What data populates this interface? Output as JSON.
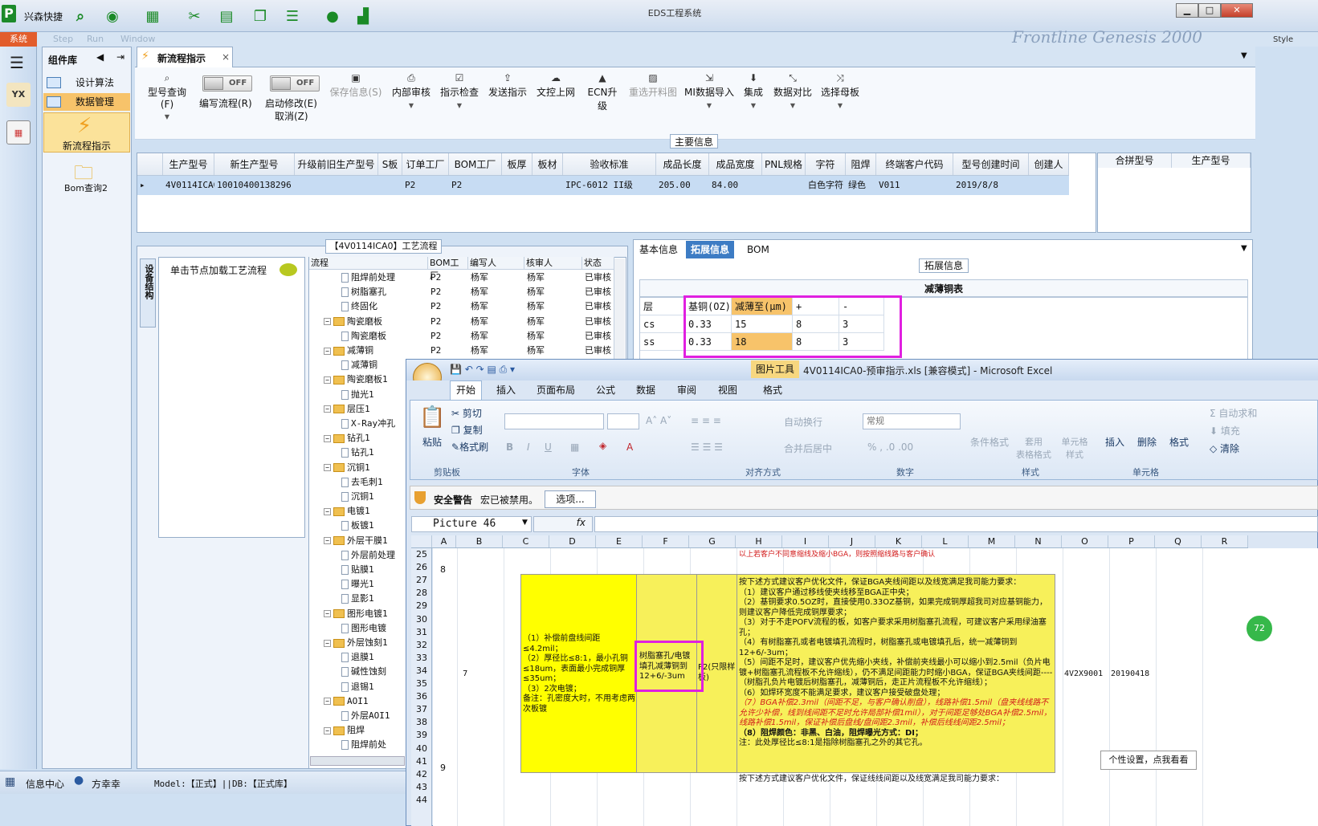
{
  "titlebar": {
    "app_logo": "P",
    "app_name": "兴森快捷",
    "window_title": "EDS工程系统",
    "win_min": "▁",
    "win_max": "□",
    "win_close": "✕",
    "icons": [
      "search-icon",
      "globe-icon",
      "grid-icon",
      "scissors-icon",
      "film-icon",
      "copy-icon",
      "list-icon",
      "user-icon",
      "chart-icon"
    ]
  },
  "menu": {
    "sys_tab": "系统",
    "ghost_items": [
      "Step",
      "Run",
      "Window"
    ],
    "brand": "Frontline Genesis 2000",
    "style_label": "Style"
  },
  "leftnav": {
    "yx": "YX",
    "calc": "▦"
  },
  "component_panel": {
    "title": "组件库",
    "items": [
      "设计算法",
      "数据管理"
    ],
    "new_flow": "新流程指示",
    "bom_query": "Bom查询2"
  },
  "doc_tab": {
    "label": "新流程指示",
    "close": "×"
  },
  "toolbar": {
    "model_query": "型号查询(F)",
    "edit_flow": "编写流程(R)",
    "enable_modify": "启动修改(E)",
    "cancel": "取消(Z)",
    "toggle_off": "OFF",
    "save_info": "保存信息(S)",
    "internal_review": "内部审核",
    "instruction_check": "指示检查",
    "send_instruction": "发送指示",
    "doc_upload": "文控上网",
    "ecn_upgrade": "ECN升级",
    "reselect_cut": "重选开料图",
    "mi_import": "MI数据导入",
    "integrate": "集成",
    "data_compare": "数据对比",
    "select_panel": "选择母板"
  },
  "main_info": {
    "caption": "主要信息",
    "headers": [
      "生产型号",
      "新生产型号",
      "升级前旧生产型号",
      "S板",
      "订单工厂",
      "BOM工厂",
      "板厚",
      "板材",
      "验收标准",
      "成品长度",
      "成品宽度",
      "PNL规格",
      "字符",
      "阻焊",
      "终端客户代码",
      "型号创建时间",
      "创建人"
    ],
    "row": [
      "4V0114ICA0",
      "10010400138296",
      "",
      "",
      "P2",
      "P2",
      "",
      "",
      "IPC-6012 II级",
      "205.00",
      "84.00",
      "",
      "白色字符",
      "绿色",
      "V011",
      "2019/8/8",
      ""
    ],
    "merge_headers": [
      "合拼型号",
      "生产型号"
    ]
  },
  "flow_panel": {
    "caption": "【4V0114ICA0】工艺流程",
    "equip_tab": "设备结构",
    "hint": "单击节点加载工艺流程",
    "headers": [
      "流程",
      "BOM工厂",
      "编写人",
      "核审人",
      "状态"
    ],
    "rows": [
      {
        "name": "阻焊前处理",
        "type": "doc",
        "indent": 2,
        "bom": "P2",
        "writer": "杨军",
        "reviewer": "杨军",
        "status": "已审核"
      },
      {
        "name": "树脂塞孔",
        "type": "doc",
        "indent": 2,
        "bom": "P2",
        "writer": "杨军",
        "reviewer": "杨军",
        "status": "已审核"
      },
      {
        "name": "终固化",
        "type": "doc",
        "indent": 2,
        "bom": "P2",
        "writer": "杨军",
        "reviewer": "杨军",
        "status": "已审核"
      },
      {
        "name": "陶瓷磨板",
        "type": "folder",
        "indent": 1,
        "bom": "P2",
        "writer": "杨军",
        "reviewer": "杨军",
        "status": "已审核"
      },
      {
        "name": "陶瓷磨板",
        "type": "doc",
        "indent": 2,
        "bom": "P2",
        "writer": "杨军",
        "reviewer": "杨军",
        "status": "已审核"
      },
      {
        "name": "减薄铜",
        "type": "folder",
        "indent": 1,
        "bom": "P2",
        "writer": "杨军",
        "reviewer": "杨军",
        "status": "已审核"
      },
      {
        "name": "减薄铜",
        "type": "doc",
        "indent": 2,
        "bom": "",
        "writer": "",
        "reviewer": "",
        "status": ""
      },
      {
        "name": "陶瓷磨板1",
        "type": "folder",
        "indent": 1,
        "bom": "",
        "writer": "",
        "reviewer": "",
        "status": ""
      },
      {
        "name": "抛光1",
        "type": "doc",
        "indent": 2,
        "bom": "",
        "writer": "",
        "reviewer": "",
        "status": ""
      },
      {
        "name": "层压1",
        "type": "folder",
        "indent": 1,
        "bom": "",
        "writer": "",
        "reviewer": "",
        "status": ""
      },
      {
        "name": "X-Ray冲孔",
        "type": "doc",
        "indent": 2,
        "bom": "",
        "writer": "",
        "reviewer": "",
        "status": ""
      },
      {
        "name": "钻孔1",
        "type": "folder",
        "indent": 1,
        "bom": "",
        "writer": "",
        "reviewer": "",
        "status": ""
      },
      {
        "name": "钻孔1",
        "type": "doc",
        "indent": 2,
        "bom": "",
        "writer": "",
        "reviewer": "",
        "status": ""
      },
      {
        "name": "沉铜1",
        "type": "folder",
        "indent": 1,
        "bom": "",
        "writer": "",
        "reviewer": "",
        "status": ""
      },
      {
        "name": "去毛刺1",
        "type": "doc",
        "indent": 2,
        "bom": "",
        "writer": "",
        "reviewer": "",
        "status": ""
      },
      {
        "name": "沉铜1",
        "type": "doc",
        "indent": 2,
        "bom": "",
        "writer": "",
        "reviewer": "",
        "status": ""
      },
      {
        "name": "电镀1",
        "type": "folder",
        "indent": 1,
        "bom": "",
        "writer": "",
        "reviewer": "",
        "status": ""
      },
      {
        "name": "板镀1",
        "type": "doc",
        "indent": 2,
        "bom": "",
        "writer": "",
        "reviewer": "",
        "status": ""
      },
      {
        "name": "外层干膜1",
        "type": "folder",
        "indent": 1,
        "bom": "",
        "writer": "",
        "reviewer": "",
        "status": ""
      },
      {
        "name": "外层前处理",
        "type": "doc",
        "indent": 2,
        "bom": "",
        "writer": "",
        "reviewer": "",
        "status": ""
      },
      {
        "name": "贴膜1",
        "type": "doc",
        "indent": 2,
        "bom": "",
        "writer": "",
        "reviewer": "",
        "status": ""
      },
      {
        "name": "曝光1",
        "type": "doc",
        "indent": 2,
        "bom": "",
        "writer": "",
        "reviewer": "",
        "status": ""
      },
      {
        "name": "显影1",
        "type": "doc",
        "indent": 2,
        "bom": "",
        "writer": "",
        "reviewer": "",
        "status": ""
      },
      {
        "name": "图形电镀1",
        "type": "folder",
        "indent": 1,
        "bom": "",
        "writer": "",
        "reviewer": "",
        "status": ""
      },
      {
        "name": "图形电镀",
        "type": "doc",
        "indent": 2,
        "bom": "",
        "writer": "",
        "reviewer": "",
        "status": ""
      },
      {
        "name": "外层蚀刻1",
        "type": "folder",
        "indent": 1,
        "bom": "",
        "writer": "",
        "reviewer": "",
        "status": ""
      },
      {
        "name": "退膜1",
        "type": "doc",
        "indent": 2,
        "bom": "",
        "writer": "",
        "reviewer": "",
        "status": ""
      },
      {
        "name": "碱性蚀刻",
        "type": "doc",
        "indent": 2,
        "bom": "",
        "writer": "",
        "reviewer": "",
        "status": ""
      },
      {
        "name": "退锡1",
        "type": "doc",
        "indent": 2,
        "bom": "",
        "writer": "",
        "reviewer": "",
        "status": ""
      },
      {
        "name": "AOI1",
        "type": "folder",
        "indent": 1,
        "bom": "",
        "writer": "",
        "reviewer": "",
        "status": ""
      },
      {
        "name": "外层AOI1",
        "type": "doc",
        "indent": 2,
        "bom": "",
        "writer": "",
        "reviewer": "",
        "status": ""
      },
      {
        "name": "阻焊",
        "type": "folder",
        "indent": 1,
        "bom": "",
        "writer": "",
        "reviewer": "",
        "status": ""
      },
      {
        "name": "阻焊前处",
        "type": "doc",
        "indent": 2,
        "bom": "",
        "writer": "",
        "reviewer": "",
        "status": ""
      }
    ]
  },
  "right_panel": {
    "tabs": [
      "基本信息",
      "拓展信息",
      "BOM"
    ],
    "ext_caption": "拓展信息",
    "thin_title": "减薄铜表",
    "thin_headers": [
      "层",
      "基铜(OZ)",
      "减薄至(μm)",
      "+",
      "-"
    ],
    "thin_rows": [
      [
        "cs",
        "0.33",
        "15",
        "8",
        "3"
      ],
      [
        "ss",
        "0.33",
        "18",
        "8",
        "3"
      ]
    ]
  },
  "excel": {
    "office_btn": "Office",
    "picture_tools": "图片工具",
    "title": "4V0114ICA0-预审指示.xls [兼容模式] - Microsoft Excel",
    "tabs": [
      "开始",
      "插入",
      "页面布局",
      "公式",
      "数据",
      "审阅",
      "视图",
      "格式"
    ],
    "clipboard": {
      "paste": "粘贴",
      "cut": "剪切",
      "copy": "复制",
      "painter": "格式刷",
      "group": "剪贴板"
    },
    "font_group": "字体",
    "align": {
      "wrap": "自动换行",
      "merge": "合并后居中",
      "group": "对齐方式"
    },
    "number": {
      "format": "常规",
      "group": "数字"
    },
    "styles": {
      "cond": "条件格式",
      "table": "套用\n表格格式",
      "cell": "单元格\n样式",
      "group": "样式"
    },
    "cells": {
      "insert": "插入",
      "delete": "删除",
      "format": "格式",
      "group": "单元格"
    },
    "editing": {
      "autosum": "自动求和",
      "fill": "填充",
      "clear": "清除"
    },
    "security": {
      "title": "安全警告",
      "message": "宏已被禁用。",
      "button": "选项..."
    },
    "namebox": "Picture 46",
    "fx": "fx",
    "columns": [
      "A",
      "B",
      "C",
      "D",
      "E",
      "F",
      "G",
      "H",
      "I",
      "J",
      "K",
      "L",
      "M",
      "N",
      "O",
      "P",
      "Q",
      "R"
    ],
    "rows": [
      "25",
      "26",
      "27",
      "28",
      "29",
      "30",
      "31",
      "32",
      "33",
      "34",
      "35",
      "36",
      "37",
      "38",
      "39",
      "40",
      "41",
      "42",
      "43",
      "44"
    ],
    "row_label_8": "8",
    "row_label_9": "9",
    "row7_no": "7",
    "top_red": "以上若客户不同意缩线及缩小BGA，则按照缩线路与客户确认",
    "cell_c": "（1）补偿前盘线间距≤4.2mil；\n（2）厚径比≤8:1，最小孔铜≤18um，表面最小完成铜厚≤35um；\n（3）2次电镀；\n备注：孔密度大时，不用考虑两次板镀",
    "cell_e": "树脂塞孔/电镀填孔减薄铜到12+6/-3um",
    "cell_f": "P2(只限样板)",
    "cell_g_lines": [
      {
        "t": "按下述方式建议客户优化文件，保证BGA夹线间距以及线宽满足我司能力要求：",
        "s": ""
      },
      {
        "t": "（1）建议客户通过移线使夹线移至BGA正中央；",
        "s": ""
      },
      {
        "t": "（2）基铜要求0.5OZ时，直接使用0.33OZ基铜，如果完成铜厚超我司对应基铜能力，则建议客户降低完成铜厚要求；",
        "s": ""
      },
      {
        "t": "（3）对于不走POFV流程的板，如客户要求采用树脂塞孔流程，可建议客户采用绿油塞孔；",
        "s": ""
      },
      {
        "t": "（4）有树脂塞孔或者电镀填孔流程时，树脂塞孔或电镀填孔后，统一减薄铜到12+6/-3um；",
        "s": ""
      },
      {
        "t": "（5）间距不足时，建议客户优先缩小夹线，补偿前夹线最小可以缩小到2.5mil（负片电镀+树脂塞孔流程板不允许缩线），仍不满足间距能力时缩小BGA，保证BGA夹线间距----（树脂孔负片电镀后树脂塞孔，减薄铜后，走正片流程板不允许缩线）；",
        "s": "red-part"
      },
      {
        "t": "（6）如焊环宽度不能满足要求，建议客户接受破盘处理；",
        "s": ""
      },
      {
        "t": "（7）BGA补偿2.3mil（间距不足，与客户确认削盘），线路补偿1.5mil（盘夹线线路不允许少补偿，线到线间距不足时允许局部补偿1mil），对于间距足够处BGA补偿2.5mil，线路补偿1.5mil，保证补偿后盘线/盘间距2.3mil，补偿后线线间距2.5mil；",
        "s": "red"
      },
      {
        "t": "（8）阻焊颜色：非黑、白油，阻焊曝光方式：DI；",
        "s": "b"
      },
      {
        "t": "注：此处厚径比≤8:1是指除树脂塞孔之外的其它孔。",
        "s": ""
      }
    ],
    "cell_n": "4V2X9001",
    "cell_o": "20190418",
    "bottom_text": "按下述方式建议客户优化文件，保证线线间距以及线宽满足我司能力要求：",
    "tooltip": "个性设置，点我看看",
    "badge": "72"
  },
  "status": {
    "info_center": "信息中心",
    "user": "方幸幸",
    "model": "Model:【正式】||DB:【正式库】"
  },
  "colors": {
    "accent": "#3d7cc4",
    "highlight": "#e020e0",
    "excel_yellow": "#f7f05a"
  }
}
